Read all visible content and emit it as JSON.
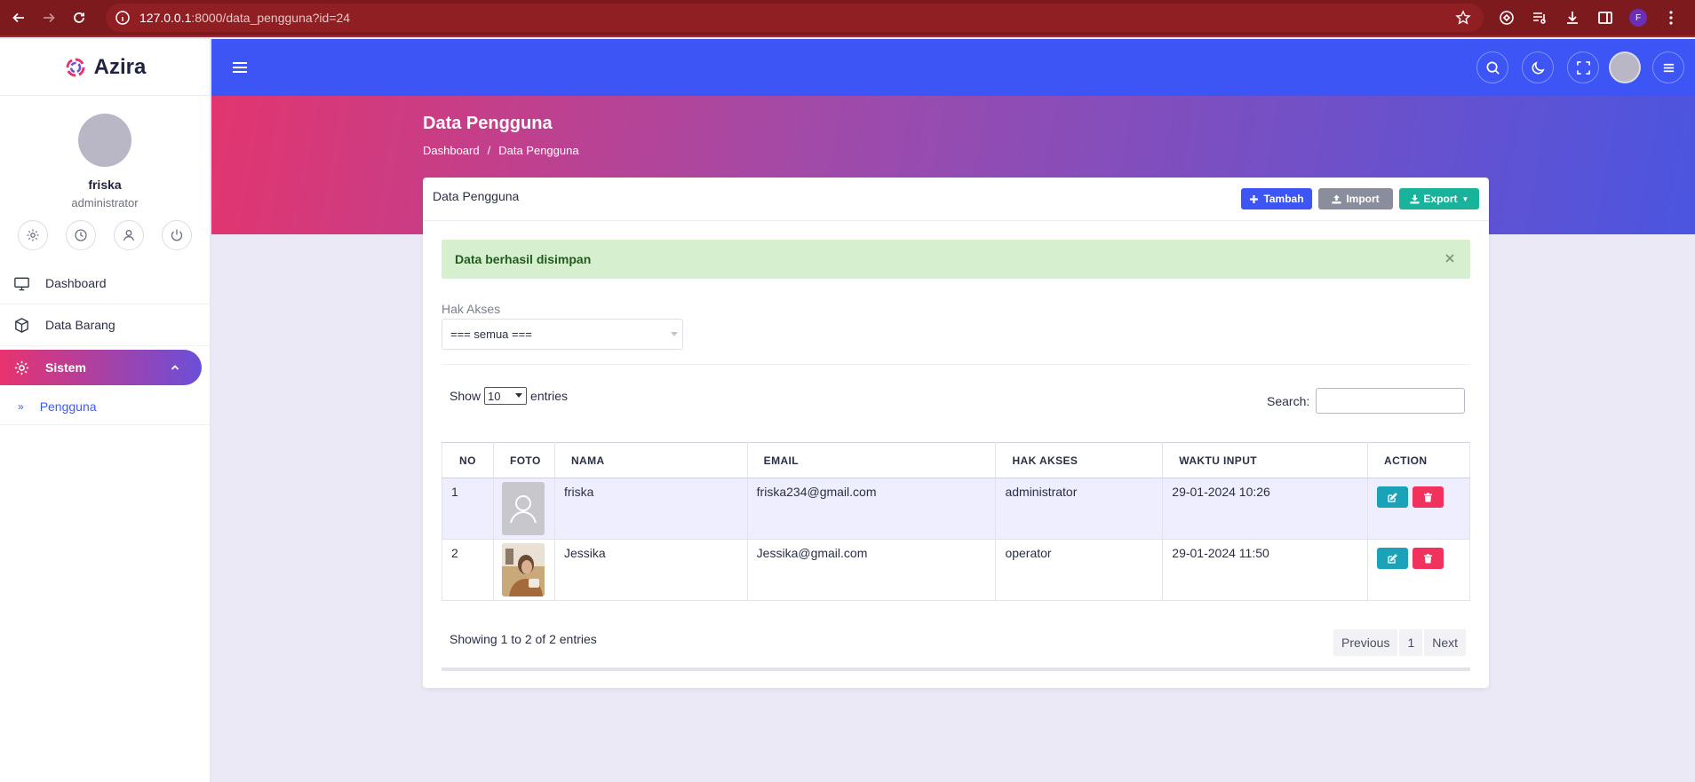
{
  "browser": {
    "url_host": "127.0.0.1",
    "url_path": ":8000/data_pengguna?id=24",
    "profile_initial": "F"
  },
  "sidebar": {
    "app_name": "Azira",
    "user_name": "friska",
    "user_role": "administrator",
    "menu": [
      {
        "label": "Dashboard",
        "icon": "monitor-icon"
      },
      {
        "label": "Data Barang",
        "icon": "box-icon"
      },
      {
        "label": "Sistem",
        "icon": "gear-icon",
        "active": true
      }
    ],
    "submenu": [
      {
        "label": "Pengguna",
        "icon": "double-chevron-icon"
      }
    ]
  },
  "page": {
    "title": "Data Pengguna",
    "breadcrumb": [
      "Dashboard",
      "/",
      "Data Pengguna"
    ]
  },
  "card": {
    "title": "Data Pengguna",
    "buttons": {
      "tambah": "Tambah",
      "import": "Import",
      "export": "Export"
    },
    "alert": "Data berhasil disimpan",
    "filter_label": "Hak Akses",
    "filter_value": "=== semua ===",
    "show_label": "Show",
    "entries_value": "10",
    "entries_label": "entries",
    "search_label": "Search:",
    "columns": [
      "NO",
      "FOTO",
      "NAMA",
      "EMAIL",
      "HAK AKSES",
      "WAKTU INPUT",
      "ACTION"
    ],
    "rows": [
      {
        "no": "1",
        "nama": "friska",
        "email": "friska234@gmail.com",
        "hak_akses": "administrator",
        "waktu": "29-01-2024 10:26",
        "foto": "default-avatar"
      },
      {
        "no": "2",
        "nama": "Jessika",
        "email": "Jessika@gmail.com",
        "hak_akses": "operator",
        "waktu": "29-01-2024 11:50",
        "foto": "photo"
      }
    ],
    "info": "Showing 1 to 2 of 2 entries",
    "pager": {
      "prev": "Previous",
      "page": "1",
      "next": "Next"
    }
  },
  "colors": {
    "primary": "#3d55f5",
    "accent_pink": "#e2356f",
    "success_bg": "#d6efcf",
    "edit": "#1aa3b8",
    "delete": "#f0325c"
  }
}
